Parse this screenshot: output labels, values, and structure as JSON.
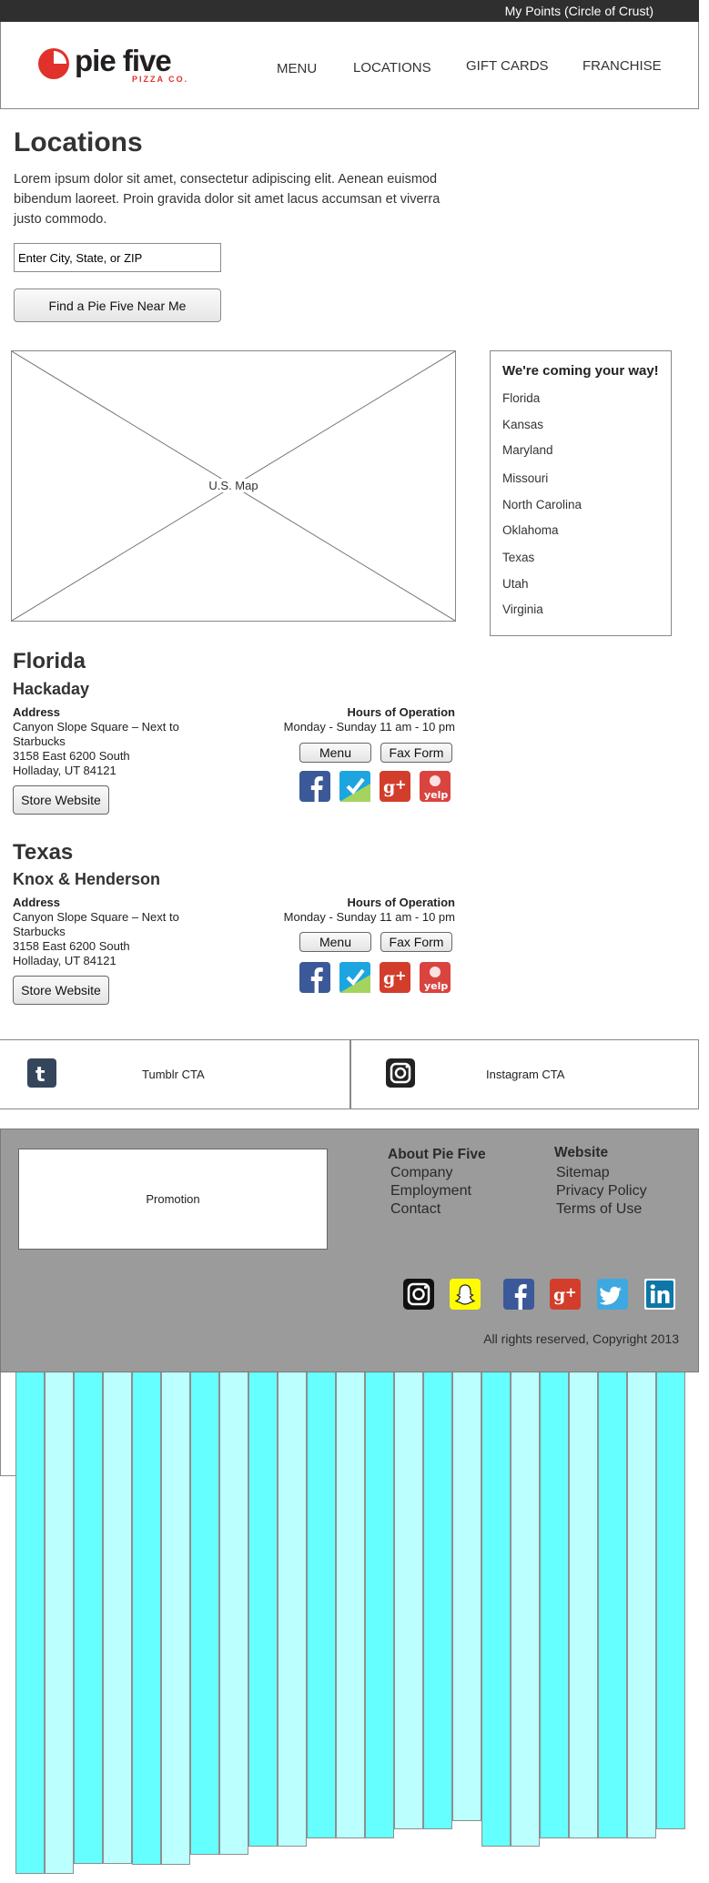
{
  "topbar": {
    "points_link": "My Points (Circle of Crust)"
  },
  "brand": {
    "name": "pie five",
    "sub": "PIZZA CO.",
    "red": "#e0312b",
    "dark": "#231f20"
  },
  "nav": [
    "MENU",
    "LOCATIONS",
    "GIFT CARDS",
    "FRANCHISE"
  ],
  "page": {
    "title": "Locations",
    "intro": "Lorem ipsum dolor sit amet, consectetur adipiscing elit. Aenean euismod bibendum laoreet. Proin gravida dolor sit amet lacus accumsan et viverra justo commodo.",
    "search_placeholder": "Enter City, State, or ZIP",
    "find_button": "Find a Pie Five Near Me",
    "map_label": "U.S. Map"
  },
  "coming": {
    "heading": "We're coming your way!",
    "states": [
      "Florida",
      "Kansas",
      "Maryland",
      "Missouri",
      "North Carolina",
      "Oklahoma",
      "Texas",
      "Utah",
      "Virginia"
    ]
  },
  "regions": [
    {
      "state": "Florida",
      "store": "Hackaday",
      "address_label": "Address",
      "address": [
        "Canyon Slope Square – Next to Starbucks",
        "3158 East 6200 South",
        "Holladay, UT  84121"
      ],
      "store_button": "Store Website",
      "hours_label": "Hours of Operation",
      "hours": "Monday - Sunday 11 am - 10 pm",
      "menu_button": "Menu",
      "fax_button": "Fax Form"
    },
    {
      "state": "Texas",
      "store": "Knox & Henderson",
      "address_label": "Address",
      "address": [
        "Canyon Slope Square – Next to Starbucks",
        "3158 East 6200 South",
        "Holladay, UT  84121"
      ],
      "store_button": "Store Website",
      "hours_label": "Hours of Operation",
      "hours": "Monday - Sunday 11 am - 10 pm",
      "menu_button": "Menu",
      "fax_button": "Fax Form"
    }
  ],
  "cta": {
    "tumblr": "Tumblr CTA",
    "instagram": "Instagram CTA"
  },
  "footer": {
    "promotion": "Promotion",
    "about_heading": "About Pie Five",
    "about_links": [
      "Company",
      "Employment",
      "Contact"
    ],
    "website_heading": "Website",
    "website_links": [
      "Sitemap",
      "Privacy Policy",
      "Terms of Use"
    ],
    "copyright": "All rights reserved, Copyright 2013"
  },
  "colors": {
    "facebook": "#3b5998",
    "foursquare": "#1da5e0",
    "google_plus": "#d23e2b",
    "yelp": "#d9443e",
    "twitter": "#3ea9e0",
    "linkedin": "#0e76a8",
    "snapchat": "#fffc00",
    "cyan_bar": "#66ffff",
    "cyan_bar_light": "#bbffff"
  }
}
